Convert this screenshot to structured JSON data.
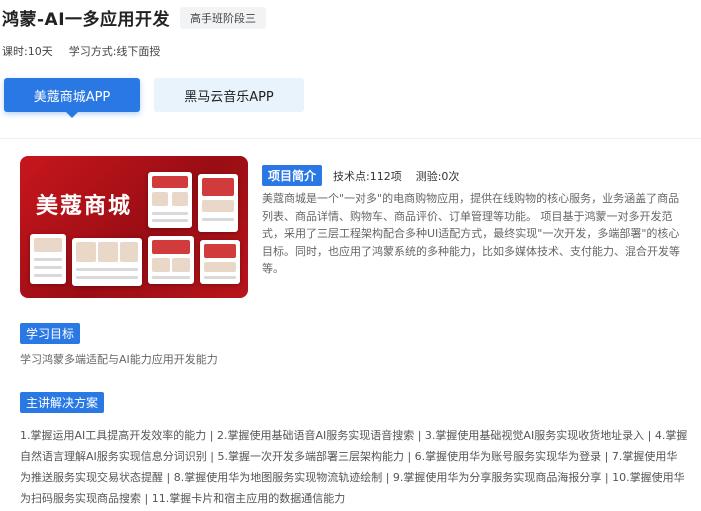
{
  "header": {
    "title": "鸿蒙-AI一多应用开发",
    "stage_badge": "高手班阶段三"
  },
  "meta": {
    "hours": "课时:10天",
    "mode": "学习方式:线下面授"
  },
  "tabs": [
    {
      "label": "美蔻商城APP",
      "active": true
    },
    {
      "label": "黑马云音乐APP",
      "active": false
    }
  ],
  "project": {
    "banner_title": "美蔻商城",
    "intro_label": "项目简介",
    "tech_points": "技术点:112项",
    "tests": "测验:0次",
    "description": "美蔻商城是一个\"一对多\"的电商购物应用，提供在线购物的核心服务，业务涵盖了商品列表、商品详情、购物车、商品评价、订单管理等功能。 项目基于鸿蒙一对多开发范式，采用了三层工程架构配合多种UI适配方式，最终实现\"一次开发，多端部署\"的核心目标。同时，也应用了鸿蒙系统的多种能力，比如多媒体技术、支付能力、混合开发等等。"
  },
  "goal": {
    "label": "学习目标",
    "text": "学习鸿蒙多端适配与AI能力应用开发能力"
  },
  "solution": {
    "label": "主讲解决方案",
    "text": "1.掌握运用AI工具提高开发效率的能力 | 2.掌握使用基础语音AI服务实现语音搜索 | 3.掌握使用基础视觉AI服务实现收货地址录入 | 4.掌握自然语言理解AI服务实现信息分词识别 | 5.掌握一次开发多端部署三层架构能力 | 6.掌握使用华为账号服务实现华为登录 | 7.掌握使用华为推送服务实现交易状态提醒 | 8.掌握使用华为地图服务实现物流轨迹绘制 | 9.掌握使用华为分享服务实现商品海报分享 | 10.掌握使用华为扫码服务实现商品搜索 | 11.掌握卡片和宿主应用的数据通信能力"
  },
  "colors": {
    "accent": "#2a78e4",
    "banner_red": "#c8161d",
    "inactive_tab": "#e8f3fc"
  }
}
